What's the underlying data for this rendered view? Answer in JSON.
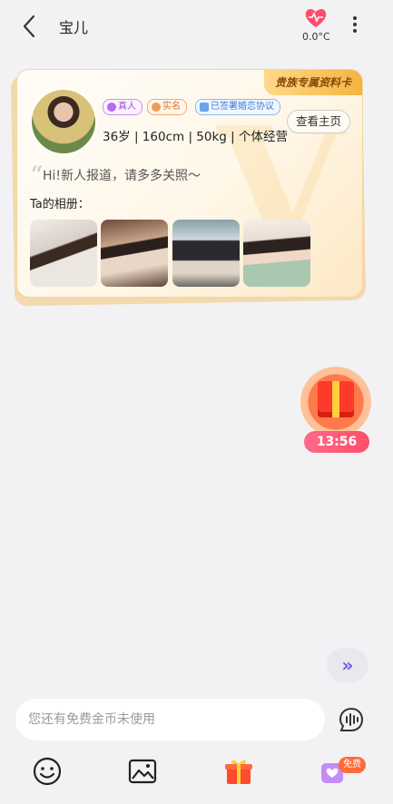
{
  "header": {
    "title": "宝儿",
    "temperature": "0.0°C",
    "icons": [
      "back-icon",
      "heart-pulse-icon",
      "more-vertical-icon"
    ]
  },
  "card": {
    "vip_tag": "贵族专属资料卡",
    "badges": [
      "真人",
      "实名",
      "已签署婚恋协议"
    ],
    "info": "36岁 | 160cm | 50kg | 个体经营",
    "home_button": "查看主页",
    "greeting": "Hi!新人报道，请多多关照～",
    "album_label": "Ta的相册：",
    "photo_count": 4
  },
  "gift_message": {
    "timer": "13:56"
  },
  "scroll_button": "»",
  "input": {
    "placeholder": "您还有免费金币未使用",
    "value": ""
  },
  "toolbar": {
    "items": [
      "emoji-icon",
      "image-icon",
      "gift-icon",
      "vip-chat-icon"
    ],
    "free_badge": "免费"
  },
  "colors": {
    "accent": "#ff4e6a",
    "vip_gold": "#f5b441",
    "scroll_purple": "#6b5ae0"
  }
}
